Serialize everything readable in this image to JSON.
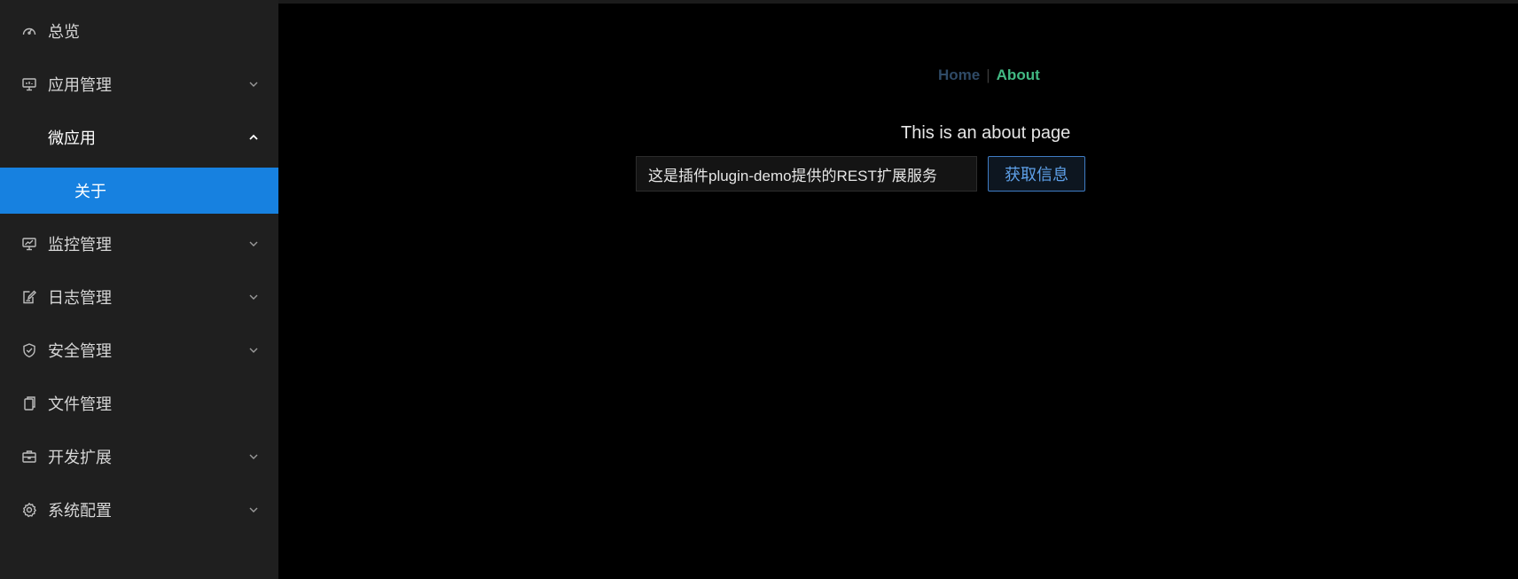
{
  "sidebar": {
    "items": [
      {
        "label": "总览",
        "icon": "dashboard-icon"
      },
      {
        "label": "应用管理",
        "icon": "monitor-icon",
        "expanded": true
      },
      {
        "label": "微应用",
        "sub": true,
        "expanded": true
      },
      {
        "label": "关于",
        "active": true
      },
      {
        "label": "监控管理",
        "icon": "chart-monitor-icon"
      },
      {
        "label": "日志管理",
        "icon": "edit-document-icon"
      },
      {
        "label": "安全管理",
        "icon": "shield-icon"
      },
      {
        "label": "文件管理",
        "icon": "files-icon"
      },
      {
        "label": "开发扩展",
        "icon": "briefcase-icon"
      },
      {
        "label": "系统配置",
        "icon": "gear-icon"
      }
    ]
  },
  "nav": {
    "home": "Home",
    "separator": "|",
    "about": "About"
  },
  "main": {
    "page_text": "This is an about page",
    "input_value": "这是插件plugin-demo提供的REST扩展服务",
    "button_label": "获取信息"
  },
  "colors": {
    "sidebar_bg": "#1f1f1f",
    "active_item": "#1781e0",
    "about_link": "#42b983",
    "button_border": "#3f7cc4"
  }
}
